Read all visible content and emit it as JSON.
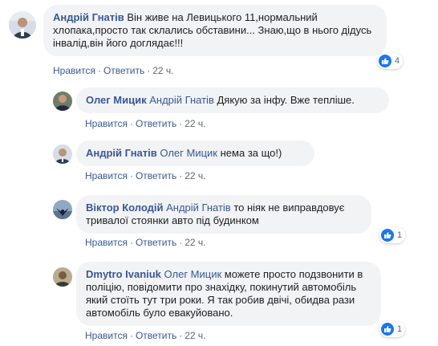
{
  "labels": {
    "like": "Нравится",
    "reply": "Ответить",
    "sep": "·"
  },
  "colors": {
    "link": "#385898",
    "bubble": "#f2f3f5",
    "like_blue": "#1877f2",
    "meta": "#606770"
  },
  "comments": [
    {
      "author": "Андрій Гнатів",
      "mention": "",
      "text": "Він живе на Левицького 11,нормальний хлопака,просто так склались обставини... Знаю,що в нього дідусь інвалід,він його доглядає!!!",
      "time": "22 ч.",
      "reactions": "4",
      "avatar_icon": "person-photo-icon"
    },
    {
      "author": "Олег Мицик",
      "mention": "Андрій Гнатів",
      "text": "Дякую за інфу. Вже тепліше.",
      "time": "22 ч.",
      "reactions": "",
      "avatar_icon": "person-photo-icon"
    },
    {
      "author": "Андрій Гнатів",
      "mention": "Олег Мицик",
      "text": "нема за що!)",
      "time": "22 ч.",
      "reactions": "",
      "avatar_icon": "person-photo-icon"
    },
    {
      "author": "Віктор Колодій",
      "mention": "Андрій Гнатів",
      "text": "то ніяк не виправдовує тривалої стоянки авто під будинком",
      "time": "22 ч.",
      "reactions": "1",
      "avatar_icon": "bird-photo-icon"
    },
    {
      "author": "Dmytro Ivaniuk",
      "mention": "Олег Мицик",
      "text": "можете просто подзвонити в поліцію, повідомити про знахідку, покинутий автомобіль який стоїть тут три роки. Я так робив двічі, обидва рази автомобіль було евакуйовано.",
      "time": "22 ч.",
      "reactions": "1",
      "avatar_icon": "person-photo-icon"
    }
  ]
}
